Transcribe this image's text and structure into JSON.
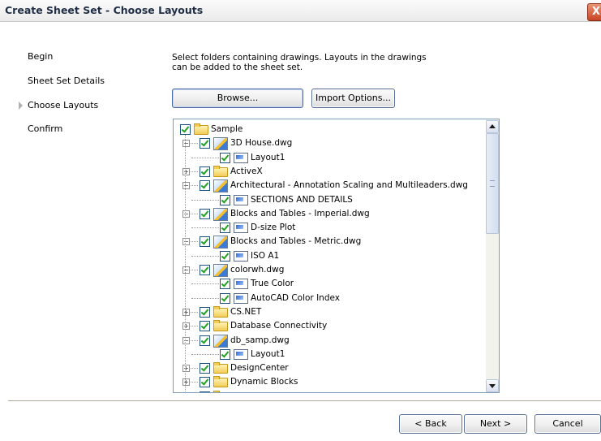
{
  "window": {
    "title": "Create Sheet Set - Choose Layouts",
    "close_glyph": "X"
  },
  "steps": [
    "Begin",
    "Sheet Set Details",
    "Choose Layouts",
    "Confirm"
  ],
  "current_step": "Choose Layouts",
  "instructions": "Select folders containing drawings.  Layouts in the drawings can be added to the sheet set.",
  "buttons": {
    "browse": "Browse...",
    "import_options": "Import Options...",
    "back": "< Back",
    "next": "Next >",
    "cancel": "Cancel"
  },
  "tree": [
    {
      "label": "Sample",
      "icon": "folder-icon",
      "level": 0,
      "expander": "",
      "checked": true
    },
    {
      "label": "3D House.dwg",
      "icon": "dwg-icon",
      "level": 1,
      "expander": "−",
      "checked": true
    },
    {
      "label": "Layout1",
      "icon": "layout-icon",
      "level": 2,
      "expander": "",
      "checked": true
    },
    {
      "label": "ActiveX",
      "icon": "folder-icon",
      "level": 1,
      "expander": "+",
      "checked": true
    },
    {
      "label": "Architectural - Annotation Scaling and Multileaders.dwg",
      "icon": "dwg-icon",
      "level": 1,
      "expander": "−",
      "checked": true
    },
    {
      "label": "SECTIONS AND DETAILS",
      "icon": "layout-icon",
      "level": 2,
      "expander": "",
      "checked": true
    },
    {
      "label": "Blocks and Tables - Imperial.dwg",
      "icon": "dwg-icon",
      "level": 1,
      "expander": "−",
      "checked": true
    },
    {
      "label": "D-size Plot",
      "icon": "layout-icon",
      "level": 2,
      "expander": "",
      "checked": true
    },
    {
      "label": "Blocks and Tables - Metric.dwg",
      "icon": "dwg-icon",
      "level": 1,
      "expander": "−",
      "checked": true
    },
    {
      "label": "ISO A1",
      "icon": "layout-icon",
      "level": 2,
      "expander": "",
      "checked": true
    },
    {
      "label": "colorwh.dwg",
      "icon": "dwg-icon",
      "level": 1,
      "expander": "−",
      "checked": true
    },
    {
      "label": "True Color",
      "icon": "layout-icon",
      "level": 2,
      "expander": "",
      "checked": true
    },
    {
      "label": "AutoCAD Color Index",
      "icon": "layout-icon",
      "level": 2,
      "expander": "",
      "checked": true
    },
    {
      "label": "CS.NET",
      "icon": "folder-icon",
      "level": 1,
      "expander": "+",
      "checked": true
    },
    {
      "label": "Database Connectivity",
      "icon": "folder-icon",
      "level": 1,
      "expander": "+",
      "checked": true
    },
    {
      "label": "db_samp.dwg",
      "icon": "dwg-icon",
      "level": 1,
      "expander": "−",
      "checked": true
    },
    {
      "label": "Layout1",
      "icon": "layout-icon",
      "level": 2,
      "expander": "",
      "checked": true
    },
    {
      "label": "DesignCenter",
      "icon": "folder-icon",
      "level": 1,
      "expander": "+",
      "checked": true
    },
    {
      "label": "Dynamic Blocks",
      "icon": "folder-icon",
      "level": 1,
      "expander": "+",
      "checked": true
    },
    {
      "label": "IFC",
      "icon": "folder-icon",
      "level": 1,
      "expander": "+",
      "checked": true
    }
  ]
}
